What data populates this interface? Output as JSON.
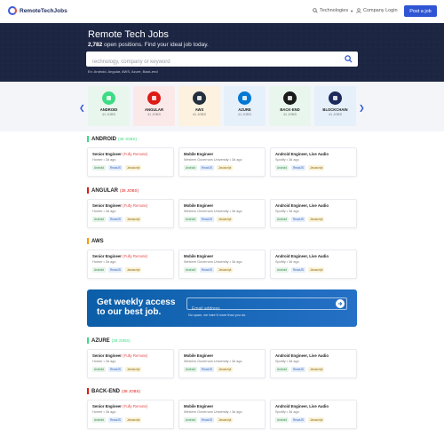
{
  "header": {
    "logo_text": "RemoteTechJobs",
    "nav_technologies": "Technologies",
    "nav_login": "Company Login",
    "post_button": "Post a job"
  },
  "hero": {
    "title": "Remote Tech Jobs",
    "count": "2,782",
    "subtitle_rest": " open positions. Find your ideal job today.",
    "search_placeholder": "Technology, company or keyword",
    "example": "Ex: Android, Angular, AWS, Azure, Back-end"
  },
  "categories": [
    {
      "name": "ANDROID",
      "count": "41 JOBS",
      "icon": "android-icon",
      "bg": "#e9f6ee",
      "icon_bg": "#3ddc84"
    },
    {
      "name": "ANGULAR",
      "count": "41 JOBS",
      "icon": "angular-icon",
      "bg": "#fbe9ea",
      "icon_bg": "#dd1b16"
    },
    {
      "name": "AWS",
      "count": "41 JOBS",
      "icon": "aws-icon",
      "bg": "#fdf1df",
      "icon_bg": "#232f3e"
    },
    {
      "name": "AZURE",
      "count": "41 JOBS",
      "icon": "azure-icon",
      "bg": "#e6f0fb",
      "icon_bg": "#0078d4"
    },
    {
      "name": "BACK-END",
      "count": "41 JOBS",
      "icon": "backend-icon",
      "bg": "#e9f6ee",
      "icon_bg": "#1a1a1a"
    },
    {
      "name": "BLOCKCHAIN",
      "count": "41 JOBS",
      "icon": "blockchain-icon",
      "bg": "#e6f0fb",
      "icon_bg": "#1d2b5c"
    }
  ],
  "sections": [
    {
      "name": "ANDROID",
      "count": "(38 JOBS)",
      "color": "#3ddc84"
    },
    {
      "name": "ANGULAR",
      "count": "(38 JOBS)",
      "color": "#dd1b16"
    },
    {
      "name": "AWS",
      "count": "",
      "color": "#ff9900"
    },
    {
      "name": "AZURE",
      "count": "(38 JOBS)",
      "color": "#3ddc84"
    },
    {
      "name": "BACK-END",
      "count": "(38 JOBS)",
      "color": "#dd1b16"
    }
  ],
  "jobs": [
    {
      "title": "Senior Engineer",
      "remote": "(Fully Remote)",
      "company": "Homer",
      "age": "3d ago"
    },
    {
      "title": "Mobile Engineer",
      "remote": "",
      "company": "Western Governors University",
      "age": "3d ago"
    },
    {
      "title": "Android Engineer, Live Audio",
      "remote": "",
      "company": "Spotify",
      "age": "3d ago"
    }
  ],
  "tags": [
    "Android",
    "ReactJS",
    "Javascript"
  ],
  "newsletter": {
    "title": "Get weekly access to our best job.",
    "email_placeholder": "Email address",
    "note": "No spam, we hate it more than you do."
  }
}
